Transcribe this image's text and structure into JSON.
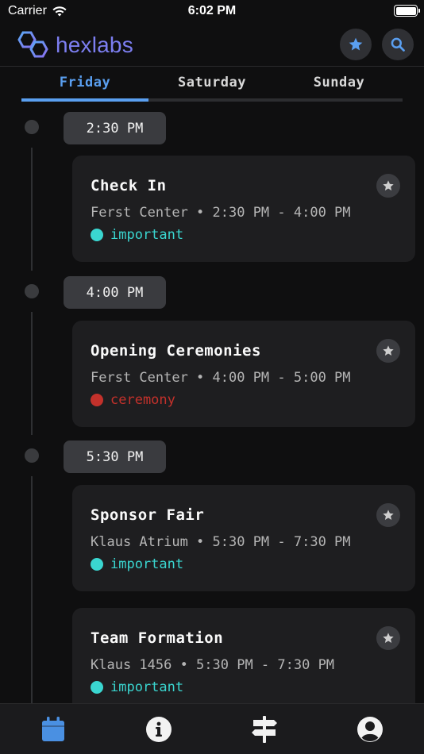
{
  "status_bar": {
    "carrier": "Carrier",
    "time": "6:02 PM"
  },
  "header": {
    "logo_text": "hexlabs",
    "brand_color": "#7c7ef0",
    "accent_color": "#5a9ff0"
  },
  "tabs": [
    {
      "label": "Friday",
      "active": true
    },
    {
      "label": "Saturday",
      "active": false
    },
    {
      "label": "Sunday",
      "active": false
    }
  ],
  "schedule": [
    {
      "time": "2:30 PM",
      "events": [
        {
          "title": "Check In",
          "meta": "Ferst Center • 2:30 PM - 4:00 PM",
          "tag": "important",
          "tag_color": "#3ad6d0"
        }
      ]
    },
    {
      "time": "4:00 PM",
      "events": [
        {
          "title": "Opening Ceremonies",
          "meta": "Ferst Center • 4:00 PM - 5:00 PM",
          "tag": "ceremony",
          "tag_color": "#c3312b"
        }
      ]
    },
    {
      "time": "5:30 PM",
      "events": [
        {
          "title": "Sponsor Fair",
          "meta": "Klaus Atrium • 5:30 PM - 7:30 PM",
          "tag": "important",
          "tag_color": "#3ad6d0"
        },
        {
          "title": "Team Formation",
          "meta": "Klaus 1456 • 5:30 PM - 7:30 PM",
          "tag": "important",
          "tag_color": "#3ad6d0"
        }
      ]
    }
  ],
  "bottom_nav": [
    {
      "icon": "calendar-icon",
      "active": true
    },
    {
      "icon": "info-icon",
      "active": false
    },
    {
      "icon": "signpost-icon",
      "active": false
    },
    {
      "icon": "user-icon",
      "active": false
    }
  ]
}
